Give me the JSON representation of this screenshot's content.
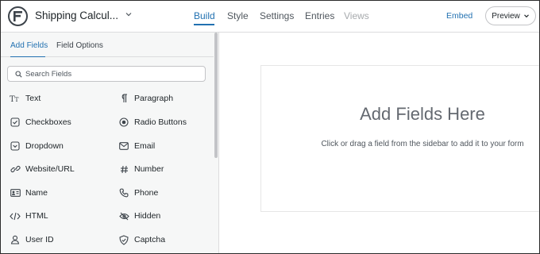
{
  "header": {
    "form_title": "Shipping Calcul...",
    "nav": [
      "Build",
      "Style",
      "Settings",
      "Entries",
      "Views"
    ],
    "embed_label": "Embed",
    "preview_label": "Preview"
  },
  "sidebar": {
    "tabs": [
      "Add Fields",
      "Field Options"
    ],
    "search_placeholder": "Search Fields",
    "fields": [
      {
        "label": "Text",
        "icon": "text-icon"
      },
      {
        "label": "Paragraph",
        "icon": "paragraph-icon"
      },
      {
        "label": "Checkboxes",
        "icon": "checkbox-icon"
      },
      {
        "label": "Radio Buttons",
        "icon": "radio-icon"
      },
      {
        "label": "Dropdown",
        "icon": "dropdown-icon"
      },
      {
        "label": "Email",
        "icon": "email-icon"
      },
      {
        "label": "Website/URL",
        "icon": "link-icon"
      },
      {
        "label": "Number",
        "icon": "hash-icon"
      },
      {
        "label": "Name",
        "icon": "id-card-icon"
      },
      {
        "label": "Phone",
        "icon": "phone-icon"
      },
      {
        "label": "HTML",
        "icon": "code-icon"
      },
      {
        "label": "Hidden",
        "icon": "eye-slash-icon"
      },
      {
        "label": "User ID",
        "icon": "user-icon"
      },
      {
        "label": "Captcha",
        "icon": "shield-check-icon"
      }
    ]
  },
  "canvas": {
    "title": "Add Fields Here",
    "hint": "Click or drag a field from the sidebar to add it to your form"
  },
  "colors": {
    "accent": "#2271b1",
    "sidebar_bg": "#f6f7f7"
  }
}
